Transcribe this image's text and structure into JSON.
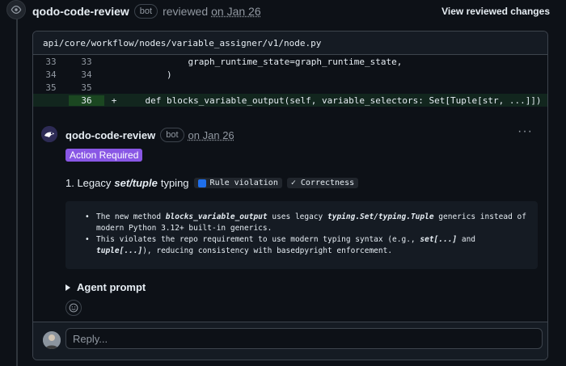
{
  "review": {
    "author": "qodo-code-review",
    "bot_label": "bot",
    "action": "reviewed",
    "date": "on Jan 26",
    "view_changes": "View reviewed changes"
  },
  "file": {
    "path": "api/core/workflow/nodes/variable_assigner/v1/node.py",
    "lines": [
      {
        "old": "33",
        "new": "33",
        "marker": "",
        "code": "            graph_runtime_state=graph_runtime_state,"
      },
      {
        "old": "34",
        "new": "34",
        "marker": "",
        "code": "        )"
      },
      {
        "old": "35",
        "new": "35",
        "marker": "",
        "code": ""
      },
      {
        "old": "",
        "new": "36",
        "marker": "+",
        "code": "    def blocks_variable_output(self, variable_selectors: Set[Tuple[str, ...]]) -> bool:"
      }
    ]
  },
  "comment": {
    "author": "qodo-code-review",
    "bot_label": "bot",
    "date": "on Jan 26",
    "more": "···",
    "badge": "Action Required",
    "title_prefix": "1. Legacy",
    "title_em": "set/tuple",
    "title_suffix": "typing",
    "tag_rule": "Rule violation",
    "tag_correct": "✓ Correctness",
    "bullet1_a": "The new method ",
    "bullet1_b": "blocks_variable_output",
    "bullet1_c": " uses legacy ",
    "bullet1_d": "typing.Set/typing.Tuple",
    "bullet1_e": " generics instead of modern Python 3.12+ built-in generics.",
    "bullet2_a": "This violates the repo requirement to use modern typing syntax (e.g., ",
    "bullet2_b": "set[...]",
    "bullet2_c": " and ",
    "bullet2_d": "tuple[...]",
    "bullet2_e": "), reducing consistency with basedpyright enforcement.",
    "agent_prompt": "Agent prompt"
  },
  "reply": {
    "placeholder": "Reply..."
  },
  "colors": {
    "accent": "#8957e5",
    "added_bg": "#12261e",
    "added_ln": "#1b4721",
    "info_blue": "#1f6feb"
  }
}
